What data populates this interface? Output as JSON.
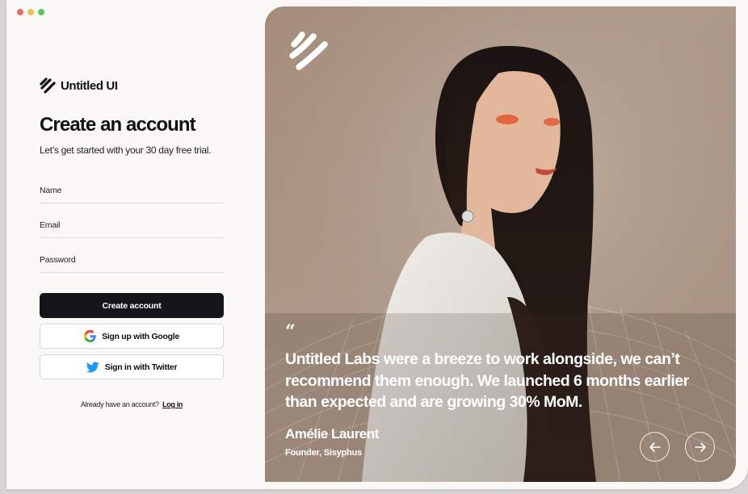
{
  "app": {
    "name": "Untitled UI"
  },
  "form": {
    "title": "Create an account",
    "subtitle": "Let’s get started with your 30 day free trial.",
    "fields": {
      "name": {
        "label": "Name",
        "value": ""
      },
      "email": {
        "label": "Email",
        "value": ""
      },
      "password": {
        "label": "Password",
        "value": ""
      }
    },
    "create_button": "Create account",
    "google_button": "Sign up with Google",
    "twitter_button": "Sign in with Twitter",
    "login_prompt": "Already have an account?",
    "login_link": "Log in"
  },
  "testimonial": {
    "quote_mark": "“",
    "quote": "Untitled Labs were a breeze to work alongside, we can’t recommend them enough. We launched 6 months earlier than expected and are growing 30% MoM.",
    "author": "Amélie Laurent",
    "role": "Founder, Sisyphus"
  },
  "icons": {
    "logo": "logo-mark-icon",
    "google": "google-icon",
    "twitter": "twitter-icon",
    "prev": "arrow-left-icon",
    "next": "arrow-right-icon"
  },
  "colors": {
    "primary_button": "#15151a",
    "page_bg": "#f9f8f6",
    "twitter_blue": "#1d9bf0"
  }
}
